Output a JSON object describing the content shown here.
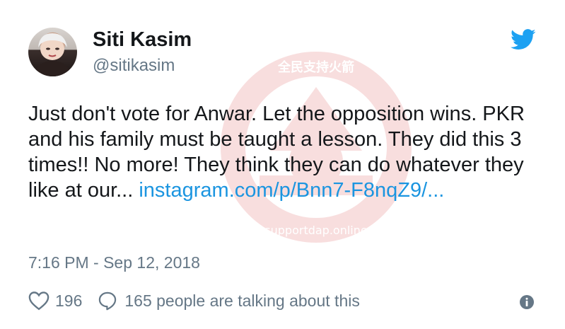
{
  "tweet": {
    "author_name": "Siti Kasim",
    "author_handle": "@sitikasim",
    "text_main": "Just don't vote for Anwar.  Let the opposition wins. PKR and his family must be taught a lesson. They did this 3 times!!  No more!  They think they can do whatever they like at our... ",
    "text_link": "instagram.com/p/Bnn7-F8nqZ9/...",
    "timestamp": "7:16 PM - Sep 12, 2018",
    "likes_count": "196",
    "talking_text": "165 people are talking about this"
  },
  "watermark": {
    "top_text": "全民支持火箭",
    "bottom_text": "supportdap.online"
  },
  "colors": {
    "twitter_blue": "#1da1f2",
    "link_blue": "#1b95e0",
    "secondary_gray": "#657786",
    "watermark_red": "#d9383a"
  },
  "icons": {
    "brand": "twitter-bird-icon",
    "like": "heart-icon",
    "reply": "speech-bubble-icon",
    "info": "info-icon"
  }
}
